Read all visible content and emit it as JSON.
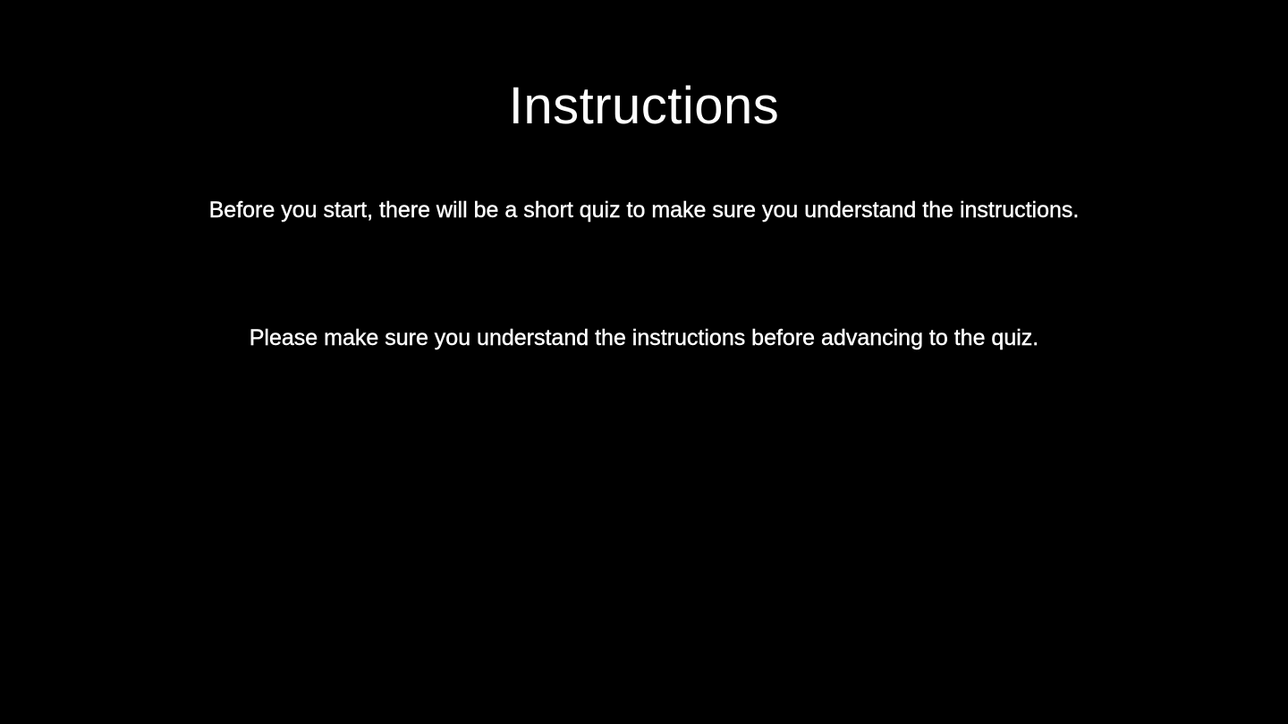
{
  "slide": {
    "title": "Instructions",
    "paragraphs": [
      "Before you start, there will be a short quiz to make sure you understand the instructions.",
      "Please make sure you understand the instructions before advancing to the quiz."
    ]
  },
  "colors": {
    "background": "#000000",
    "text": "#ffffff"
  }
}
